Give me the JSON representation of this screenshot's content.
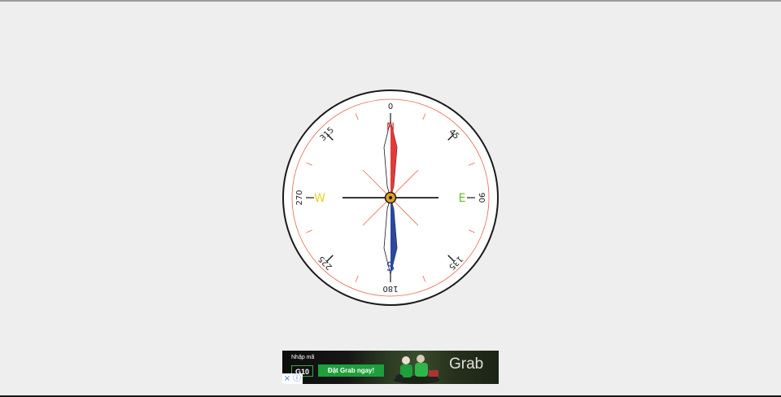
{
  "compass": {
    "degree_labels": [
      "0",
      "45",
      "90",
      "135",
      "180",
      "225",
      "270",
      "315"
    ],
    "cardinals": {
      "north": {
        "label": "N",
        "color": "#e23a3a"
      },
      "east": {
        "label": "E",
        "color": "#66c21a"
      },
      "south": {
        "label": "S",
        "color": "#2a48a0"
      },
      "west": {
        "label": "W",
        "color": "#e6d31c"
      }
    },
    "colors": {
      "outer_ring": "#1a1a1a",
      "inner_ring": "#e8664a",
      "tick_minor": "#e8664a",
      "tick_major": "#1a1a1a",
      "needle_north": "#e23a3a",
      "needle_south": "#2a48a0",
      "hub": "#e0a020"
    }
  },
  "ad": {
    "promo_label": "Nhập mã",
    "promo_code": "G10",
    "cta_label": "Đặt Grab ngay!",
    "brand": "Grab",
    "close_icon": "×",
    "info_icon": "ⓘ"
  }
}
